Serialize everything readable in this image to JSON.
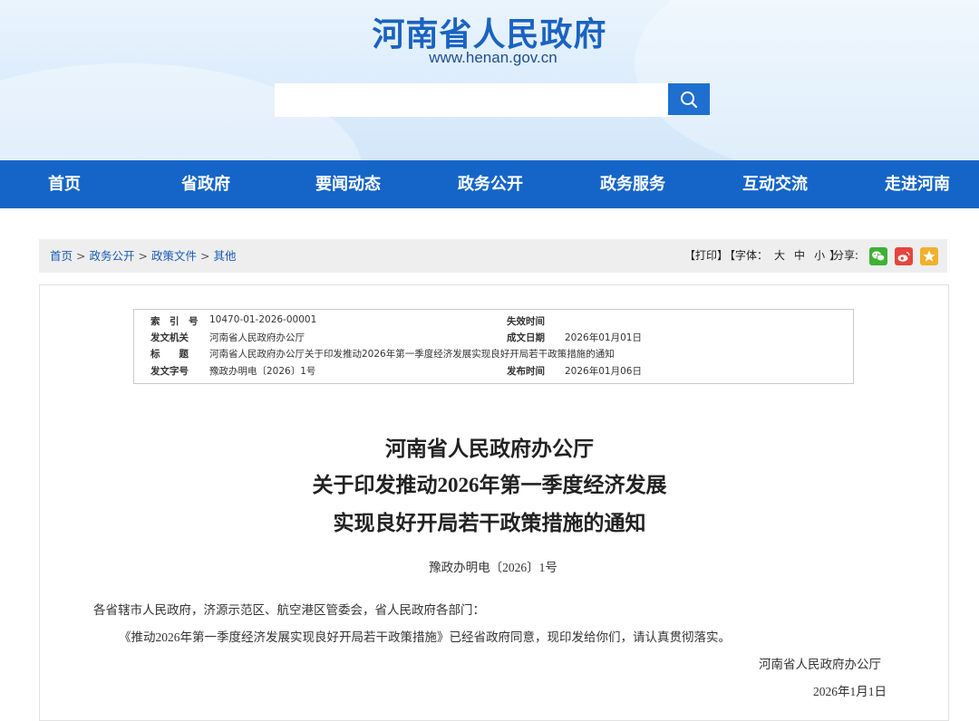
{
  "header": {
    "site_title": "河南省人民政府",
    "site_url": "www.henan.gov.cn",
    "search_placeholder": ""
  },
  "nav": {
    "items": [
      "首页",
      "省政府",
      "要闻动态",
      "政务公开",
      "政务服务",
      "互动交流",
      "走进河南"
    ]
  },
  "breadcrumb": {
    "items": [
      "首页",
      "政务公开",
      "政策文件",
      "其他"
    ],
    "separator": ">"
  },
  "tools": {
    "print": "【打印】",
    "font_label": "【字体：",
    "font_large": "大",
    "font_medium": "中",
    "font_small": "小",
    "font_close": "】",
    "share_label": "分享:",
    "share_icons": [
      "wechat-icon",
      "weibo-icon",
      "favorite-icon"
    ],
    "share_colors": [
      "#3db234",
      "#e6443d",
      "#f0b22b"
    ]
  },
  "meta": {
    "index_label": "索　引　号",
    "index_value": "10470-01-2026-00001",
    "expire_label": "失效时间",
    "expire_value": "",
    "issuer_label": "发文机关",
    "issuer_value": "河南省人民政府办公厅",
    "made_label": "成文日期",
    "made_value": "2026年01月01日",
    "title_label": "标　　题",
    "title_value": "河南省人民政府办公厅关于印发推动2026年第一季度经济发展实现良好开局若干政策措施的通知",
    "docno_label": "发文字号",
    "docno_value": "豫政办明电〔2026〕1号",
    "publish_label": "发布时间",
    "publish_value": "2026年01月06日"
  },
  "document": {
    "title_line1": "河南省人民政府办公厅",
    "title_line2": "关于印发推动2026年第一季度经济发展",
    "title_line3": "实现良好开局若干政策措施的通知",
    "doc_number": "豫政办明电〔2026〕1号",
    "salutation": "各省辖市人民政府，济源示范区、航空港区管委会，省人民政府各部门：",
    "body": "《推动2026年第一季度经济发展实现良好开局若干政策措施》已经省政府同意，现印发给你们，请认真贯彻落实。",
    "signature": "河南省人民政府办公厅",
    "date": "2026年1月1日"
  },
  "colors": {
    "nav_bg": "#1565c8",
    "title_blue": "#1a63c0",
    "link_blue": "#1a5bb5"
  }
}
